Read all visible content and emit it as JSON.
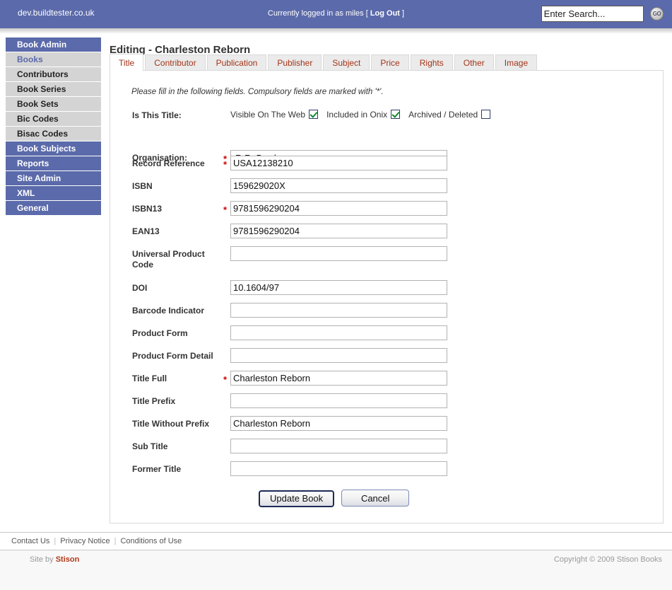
{
  "topbar": {
    "domain": "dev.buildtester.co.uk",
    "login_prefix": "Currently logged in as miles [ ",
    "logout_label": "Log Out",
    "login_suffix": " ]",
    "search_placeholder": "Enter Search...",
    "search_value": "",
    "go_label": "GO",
    "background_color": "#5b6aaa"
  },
  "sidebar": {
    "items": [
      {
        "label": "Book Admin",
        "type": "head",
        "active": false
      },
      {
        "label": "Books",
        "type": "sub",
        "active": true
      },
      {
        "label": "Contributors",
        "type": "sub",
        "active": false
      },
      {
        "label": "Book Series",
        "type": "sub",
        "active": false
      },
      {
        "label": "Book Sets",
        "type": "sub",
        "active": false
      },
      {
        "label": "Bic Codes",
        "type": "sub",
        "active": false
      },
      {
        "label": "Bisac Codes",
        "type": "sub",
        "active": false
      },
      {
        "label": "Book Subjects",
        "type": "head",
        "active": false
      },
      {
        "label": "Reports",
        "type": "head",
        "active": false
      },
      {
        "label": "Site Admin",
        "type": "head",
        "active": false
      },
      {
        "label": "XML",
        "type": "head",
        "active": false
      },
      {
        "label": "General",
        "type": "head",
        "active": false
      }
    ]
  },
  "main": {
    "page_title": "Editing - Charleston Reborn",
    "instructions": "Please fill in the following fields. Compulsory fields are marked with '*'.",
    "tabs": [
      {
        "label": "Title",
        "active": true
      },
      {
        "label": "Contributor",
        "active": false
      },
      {
        "label": "Publication",
        "active": false
      },
      {
        "label": "Publisher",
        "active": false
      },
      {
        "label": "Subject",
        "active": false
      },
      {
        "label": "Price",
        "active": false
      },
      {
        "label": "Rights",
        "active": false
      },
      {
        "label": "Other",
        "active": false
      },
      {
        "label": "Image",
        "active": false
      }
    ],
    "tab_text_color": "#a33418"
  },
  "form": {
    "is_this_title": {
      "label": "Is This Title:",
      "checkboxes": [
        {
          "label": "Visible On The Web",
          "checked": true
        },
        {
          "label": "Included in Onix",
          "checked": true
        },
        {
          "label": "Archived / Deleted",
          "checked": false
        }
      ]
    },
    "organisation": {
      "label": "Organisation:",
      "required": true,
      "value": "R.R. Bowker",
      "options": [
        "R.R. Bowker"
      ]
    },
    "fields": [
      {
        "label": "Record Reference",
        "required": true,
        "value": "USA12138210",
        "placeholder": ""
      },
      {
        "label": "ISBN",
        "required": false,
        "value": "159629020X",
        "placeholder": ""
      },
      {
        "label": "ISBN13",
        "required": true,
        "value": "9781596290204",
        "placeholder": ""
      },
      {
        "label": "EAN13",
        "required": false,
        "value": "9781596290204",
        "placeholder": ""
      },
      {
        "label": "Universal Product Code",
        "required": false,
        "value": "",
        "placeholder": ""
      },
      {
        "label": "DOI",
        "required": false,
        "value": "10.1604/97",
        "placeholder": ""
      },
      {
        "label": "Barcode Indicator",
        "required": false,
        "value": "",
        "placeholder": ""
      },
      {
        "label": "Product Form",
        "required": false,
        "value": "",
        "placeholder": ""
      },
      {
        "label": "Product Form Detail",
        "required": false,
        "value": "",
        "placeholder": ""
      },
      {
        "label": "Title Full",
        "required": true,
        "value": "Charleston Reborn",
        "placeholder": ""
      },
      {
        "label": "Title Prefix",
        "required": false,
        "value": "",
        "placeholder": ""
      },
      {
        "label": "Title Without Prefix",
        "required": false,
        "value": "Charleston Reborn",
        "placeholder": ""
      },
      {
        "label": "Sub Title",
        "required": false,
        "value": "",
        "placeholder": ""
      },
      {
        "label": "Former Title",
        "required": false,
        "value": "",
        "placeholder": ""
      }
    ],
    "buttons": [
      {
        "label": "Update Book",
        "focused": true
      },
      {
        "label": "Cancel",
        "focused": false
      }
    ]
  },
  "footer": {
    "links": [
      "Contact Us",
      "Privacy Notice",
      "Conditions of Use"
    ],
    "site_by_prefix": "Site by ",
    "site_by_name": "Stison",
    "copyright": "Copyright © 2009 Stison Books"
  }
}
